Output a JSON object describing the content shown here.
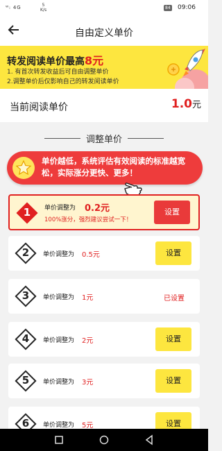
{
  "status_bar": {
    "signal": "ᵂᵢ 4G",
    "speed_value": "5",
    "speed_unit": "K/s",
    "battery": "84",
    "time": "09:06"
  },
  "app_bar": {
    "back_icon": "arrow-left-icon",
    "title": "自由定义单价"
  },
  "banner": {
    "heading_prefix": "转发阅读单价最高",
    "heading_highlight": "8元",
    "line1": "1. 有首次转发收益后可自由调整单价",
    "line2": "2.调整单价后仅影响自己的转发阅读单价",
    "art": "rocket-coin-illustration"
  },
  "current_price": {
    "label": "当前阅读单价",
    "value": "1.0",
    "unit": "元"
  },
  "section": {
    "title": "调整单价"
  },
  "tip": {
    "icon": "star-icon",
    "text": "单价越低，系统评估有效阅读的标准越宽松，实际涨分更快、更多！"
  },
  "options": [
    {
      "num": "1",
      "label": "单价调整为",
      "amount": "0.2元",
      "note": "100%涨分，强烈建议尝试一下！",
      "button": "设置",
      "state": "active"
    },
    {
      "num": "2",
      "label": "单价调整为",
      "amount": "0.5元",
      "button": "设置",
      "state": "normal"
    },
    {
      "num": "3",
      "label": "单价调整为",
      "amount": "1元",
      "status": "已设置",
      "state": "current"
    },
    {
      "num": "4",
      "label": "单价调整为",
      "amount": "2元",
      "button": "设置",
      "state": "normal"
    },
    {
      "num": "5",
      "label": "单价调整为",
      "amount": "3元",
      "button": "设置",
      "state": "normal"
    },
    {
      "num": "6",
      "label": "单价调整为",
      "amount": "5元",
      "button": "设置",
      "state": "normal"
    }
  ],
  "colors": {
    "accent_red": "#e02020",
    "banner_yellow": "#fde63f",
    "button_yellow": "#fde63f",
    "tip_red": "#ee3c3c"
  }
}
